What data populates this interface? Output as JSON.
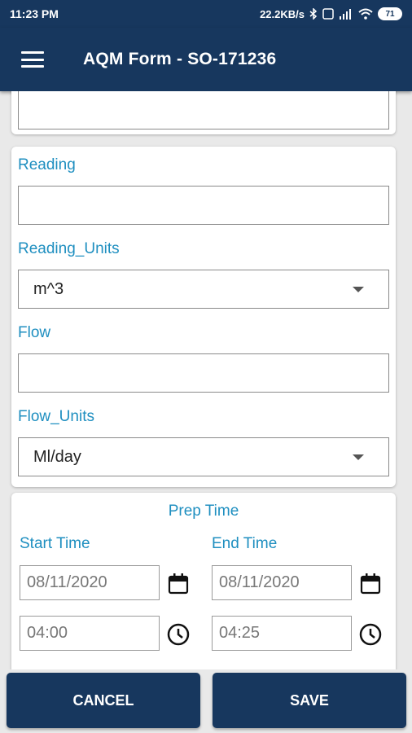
{
  "status_bar": {
    "time": "11:23 PM",
    "network_speed": "22.2KB/s",
    "battery": "71"
  },
  "app_bar": {
    "menu_icon": "hamburger-menu-icon",
    "title": "AQM Form - SO-171236"
  },
  "form": {
    "top_field_value": "",
    "reading": {
      "label": "Reading",
      "value": ""
    },
    "reading_units": {
      "label": "Reading_Units",
      "selected": "m^3"
    },
    "flow": {
      "label": "Flow",
      "value": ""
    },
    "flow_units": {
      "label": "Flow_Units",
      "selected": "Ml/day"
    }
  },
  "prep_time": {
    "title": "Prep Time",
    "start": {
      "label": "Start Time",
      "date": "08/11/2020",
      "time": "04:00"
    },
    "end": {
      "label": "End Time",
      "date": "08/11/2020",
      "time": "04:25"
    },
    "calendar_icon": "calendar-icon",
    "clock_icon": "clock-icon"
  },
  "actions": {
    "cancel_label": "CANCEL",
    "save_label": "SAVE"
  },
  "colors": {
    "primary": "#17375e",
    "accent_label": "#1f8fc0",
    "background": "#e9e9e9"
  }
}
